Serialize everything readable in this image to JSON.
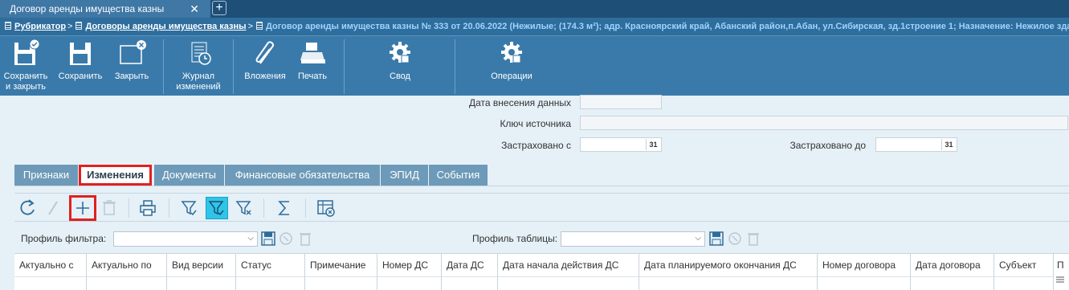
{
  "window_tab": {
    "title": "Договор аренды имущества казны",
    "close": "✕",
    "add": "+"
  },
  "breadcrumb": {
    "items": [
      "Рубрикатор",
      "Договоры аренды имущества казны"
    ],
    "current": "Договор аренды имущества казны № 333 от 20.06.2022 (Нежилые; (174.3 м²); адр. Красноярский край, Абанский район,п.Абан, ул.Сибирская, зд.1строение 1; Назначение: Нежилое здание)",
    "separator": ">"
  },
  "ribbon": {
    "save_close": "Сохранить и закрыть",
    "save": "Сохранить",
    "close": "Закрыть",
    "journal": "Журнал изменений",
    "attachments": "Вложения",
    "print": "Печать",
    "summary": "Свод",
    "operations": "Операции"
  },
  "form": {
    "data_entry_date_label": "Дата внесения данных",
    "source_key_label": "Ключ источника",
    "insured_from_label": "Застраховано с",
    "insured_to_label": "Застраховано до",
    "calendar_glyph": "31"
  },
  "tabs": [
    {
      "label": "Признаки"
    },
    {
      "label": "Изменения"
    },
    {
      "label": "Документы"
    },
    {
      "label": "Финансовые обязательства"
    },
    {
      "label": "ЭПИД"
    },
    {
      "label": "События"
    }
  ],
  "filter": {
    "filter_profile_label": "Профиль фильтра:",
    "table_profile_label": "Профиль таблицы:",
    "dropdown_arrow": "⌵"
  },
  "table": {
    "columns": [
      "Актуально с",
      "Актуально по",
      "Вид версии",
      "Статус",
      "Примечание",
      "Номер ДС",
      "Дата ДС",
      "Дата начала действия ДС",
      "Дата планируемого окончания ДС",
      "Номер договора",
      "Дата договора",
      "Субъект",
      "П"
    ]
  },
  "colors": {
    "accent": "#3a7aaa",
    "highlight": "#e02020",
    "active_filter": "#2ec5e8"
  }
}
